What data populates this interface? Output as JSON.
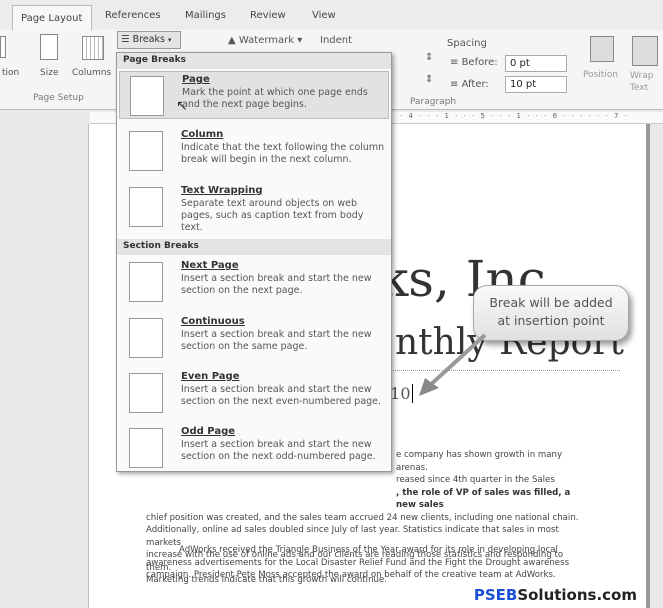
{
  "tabs": [
    "Page Layout",
    "References",
    "Mailings",
    "Review",
    "View"
  ],
  "ribbon": {
    "orientation_label": "tion",
    "size_label": "Size",
    "columns_label": "Columns",
    "page_setup_group": "Page Setup",
    "breaks_label": "Breaks",
    "watermark_label": "Watermark",
    "indent_label": "Indent",
    "spacing_label": "Spacing",
    "before_label": "Before:",
    "before_value": "0 pt",
    "after_label": "After:",
    "after_value": "10 pt",
    "paragraph_group": "Paragraph",
    "position_label": "Position",
    "wrap_label": "Wrap",
    "wrap_label2": "Text"
  },
  "ruler": "· 4 · · · 1 · · · 5 · · · 1 · · · 6 · · · · · · 7 ·",
  "menu": {
    "page_breaks_header": "Page Breaks",
    "section_breaks_header": "Section Breaks",
    "items": [
      {
        "title": "Page",
        "desc": "Mark the point at which one page ends and the next page begins."
      },
      {
        "title": "Column",
        "desc": "Indicate that the text following the column break will begin in the next column."
      },
      {
        "title": "Text Wrapping",
        "desc": "Separate text around objects on web pages, such as caption text from body text."
      },
      {
        "title": "Next Page",
        "desc": "Insert a section break and start the new section on the next page."
      },
      {
        "title": "Continuous",
        "desc": "Insert a section break and start the new section on the same page."
      },
      {
        "title": "Even Page",
        "desc": "Insert a section break and start the new section on the next even-numbered page."
      },
      {
        "title": "Odd Page",
        "desc": "Insert a section break and start the new section on the next odd-numbered page."
      }
    ]
  },
  "document": {
    "title": "ks, Inc",
    "subtitle": "nthly Report",
    "date": "010",
    "para1_lines": [
      "e company has shown growth in many arenas.",
      "reased since 4th quarter in the Sales",
      ", the role of VP of sales was filled, a new sales",
      "chief position was created, and the sales team accrued 24 new clients, including one national chain.",
      "Additionally, online ad sales doubled since July of last year. Statistics indicate that sales in most markets",
      "increase with the use of online ads and our clients are reading those statistics and responding to them.",
      "Marketing trends indicate that this growth will continue."
    ],
    "para2_lines": [
      "AdWorks received the Triangle Business of the Year award for its role in developing local",
      "awareness advertisements for the Local Disaster Relief Fund and the Fight the Drought awareness",
      "campaign.  President Pete Moss accepted the award on behalf of the creative team at AdWorks."
    ]
  },
  "callout": {
    "line1": "Break will be added",
    "line2": "at insertion point"
  },
  "watermark": {
    "part1": "PSEB",
    "part2": "Solutions.com",
    "color1": "#1a4fd6",
    "color2": "#222"
  }
}
